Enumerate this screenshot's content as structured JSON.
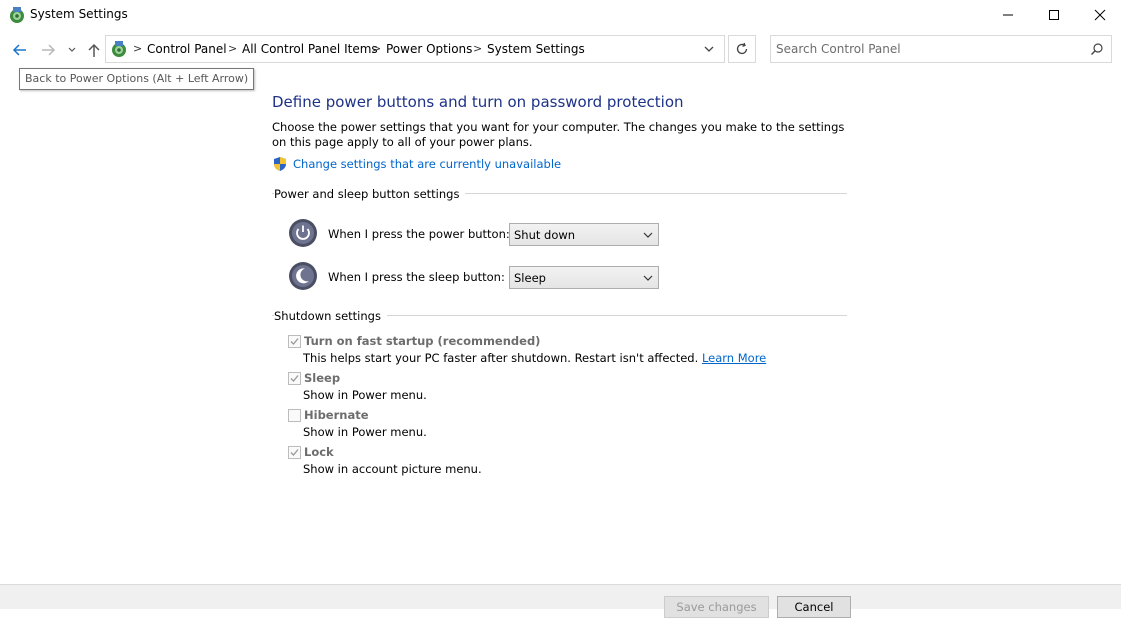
{
  "window": {
    "title": "System Settings",
    "controls": {
      "minimize": "minimize-icon",
      "maximize": "maximize-icon",
      "close": "close-icon"
    }
  },
  "nav": {
    "back_icon": "arrow-left-icon",
    "forward_icon": "arrow-right-icon",
    "recent_icon": "chevron-down-icon",
    "up_icon": "arrow-up-icon",
    "breadcrumbs": [
      "Control Panel",
      "All Control Panel Items",
      "Power Options",
      "System Settings"
    ],
    "separator": ">",
    "refresh_icon": "refresh-icon",
    "search_placeholder": "Search Control Panel"
  },
  "tooltip": "Back to Power Options (Alt + Left Arrow)",
  "main": {
    "title": "Define power buttons and turn on password protection",
    "intro": "Choose the power settings that you want for your computer. The changes you make to the settings on this page apply to all of your power plans.",
    "change_link": "Change settings that are currently unavailable",
    "power_section": {
      "label": "Power and sleep button settings",
      "rows": [
        {
          "label": "When I press the power button:",
          "value": "Shut down"
        },
        {
          "label": "When I press the sleep button:",
          "value": "Sleep"
        }
      ]
    },
    "shutdown_section": {
      "label": "Shutdown settings",
      "options": [
        {
          "label": "Turn on fast startup (recommended)",
          "desc": "This helps start your PC faster after shutdown. Restart isn't affected.",
          "checked": true
        },
        {
          "label": "Sleep",
          "desc": "Show in Power menu.",
          "checked": true
        },
        {
          "label": "Hibernate",
          "desc": "Show in Power menu.",
          "checked": false
        },
        {
          "label": "Lock",
          "desc": "Show in account picture menu.",
          "checked": true
        }
      ],
      "learn_more": "Learn More"
    }
  },
  "footer": {
    "save_label": "Save changes",
    "cancel_label": "Cancel"
  },
  "colors": {
    "title_blue": "#1e3287",
    "link_blue": "#0066cc",
    "disabled_text": "#6d6d6d"
  }
}
